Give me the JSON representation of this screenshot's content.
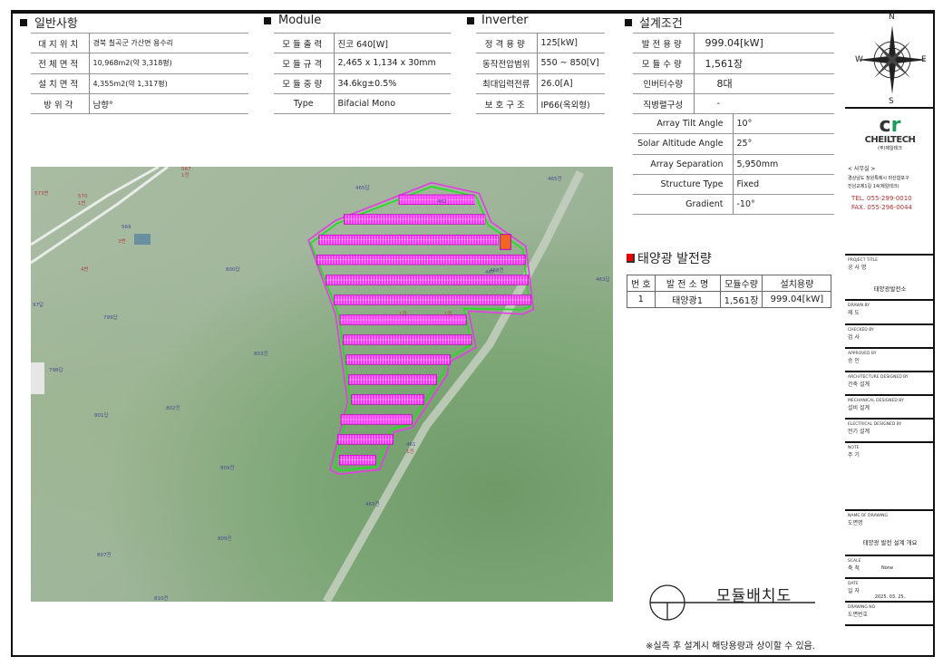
{
  "general": {
    "title": "일반사항",
    "rows": [
      {
        "label": "대지위치",
        "value": "경북 칠곡군 가산면 용수리"
      },
      {
        "label": "전체면적",
        "value": "10,968m2(약 3,318평)"
      },
      {
        "label": "설치면적",
        "value": "4,355m2(약 1,317평)"
      },
      {
        "label": "방위각",
        "value": "남향°"
      }
    ]
  },
  "module": {
    "title": "Module",
    "rows": [
      {
        "label": "모듈출력",
        "value": "진코 640[W]"
      },
      {
        "label": "모듈규격",
        "value": "2,465 x 1,134 x 30mm"
      },
      {
        "label": "모듈중량",
        "value": "34.6kg±0.5%"
      },
      {
        "label": "Type",
        "value": "Bifacial Mono"
      }
    ]
  },
  "inverter": {
    "title": "Inverter",
    "rows": [
      {
        "label": "정격용량",
        "value": "125[kW]"
      },
      {
        "label": "동작전압범위",
        "value": "550 ~ 850[V]"
      },
      {
        "label": "최대입력전류",
        "value": "26.0[A]"
      },
      {
        "label": "보호구조",
        "value": "IP66(옥외형)"
      }
    ]
  },
  "design": {
    "title": "설계조건",
    "rows": [
      {
        "label": "발전용량",
        "value": "999.04[kW]"
      },
      {
        "label": "모듈수량",
        "value": "1,561장"
      },
      {
        "label": "인버터수량",
        "value": "8대"
      },
      {
        "label": "직병렬구성",
        "value": "-"
      }
    ],
    "rows_en": [
      {
        "label": "Array Tilt Angle",
        "value": "10°"
      },
      {
        "label": "Solar Altitude Angle",
        "value": "25°"
      },
      {
        "label": "Array Separation",
        "value": "5,950mm"
      },
      {
        "label": "Structure Type",
        "value": "Fixed"
      },
      {
        "label": "Gradient",
        "value": "-10°"
      }
    ]
  },
  "generation": {
    "title": "태양광 발전량",
    "headers": [
      "번 호",
      "발 전 소 명",
      "모듈수량",
      "설치용량"
    ],
    "rows": [
      [
        "1",
        "태양광1",
        "1,561장",
        "999.04[kW]"
      ]
    ]
  },
  "map_labels": [
    "573번",
    "570",
    "1번",
    "569",
    "3번",
    "4번",
    "800답",
    "799답",
    "97답",
    "798답",
    "803전",
    "802전",
    "801답",
    "809전",
    "807전",
    "809전",
    "810전",
    "465답",
    "465전",
    "463답",
    "462",
    "467",
    "468전",
    "461",
    "1전",
    "463전",
    "567",
    "1전",
    "1전",
    "1전"
  ],
  "drawing_title": "모듈배치도",
  "note": "※실측 후 설계시 해당용량과 상이할 수 있음.",
  "compass": {
    "n": "N",
    "s": "S",
    "e": "E",
    "w": "W"
  },
  "company": {
    "logo": "CHEILTECH",
    "logo_sub": "(주)제일테크",
    "office": "< 사무실 >",
    "address1": "경상남도 창원특례시 마산합포구",
    "address2": "진남교제1길 14(제일테크)",
    "tel": "TEL. 055-299-0010",
    "fax": "FAX. 055-296-0044"
  },
  "title_block": [
    {
      "en": "PROJECT TITLE",
      "ko": "공 사 명",
      "value": "태양광발전소"
    },
    {
      "en": "DRAWN BY",
      "ko": "제 도",
      "value": ""
    },
    {
      "en": "CHECKED BY",
      "ko": "검 사",
      "value": ""
    },
    {
      "en": "APPROVED BY",
      "ko": "승 인",
      "value": ""
    },
    {
      "en": "ARCHITECTURE DESIGNED BY",
      "ko": "건축 설계",
      "value": ""
    },
    {
      "en": "MECHANICAL DESIGNED BY",
      "ko": "설비 설계",
      "value": ""
    },
    {
      "en": "ELECTRICAL DESIGNED BY",
      "ko": "전기 설계",
      "value": ""
    },
    {
      "en": "NOTE",
      "ko": "주 기",
      "value": ""
    },
    {
      "en": "NAME OF DRAWING",
      "ko": "도면명",
      "value": "태양광 발전 설계 개요"
    },
    {
      "en": "SCALE",
      "ko": "축 척",
      "value": "None"
    },
    {
      "en": "DATE",
      "ko": "일 자",
      "value": "2025. 03. 25."
    },
    {
      "en": "DRAWING NO",
      "ko": "도면번호",
      "value": ""
    }
  ],
  "colors": {
    "array": "#ff33ff",
    "boundary": "#e040e0",
    "fence": "#22dd22",
    "inverter_box": "#f26522"
  }
}
